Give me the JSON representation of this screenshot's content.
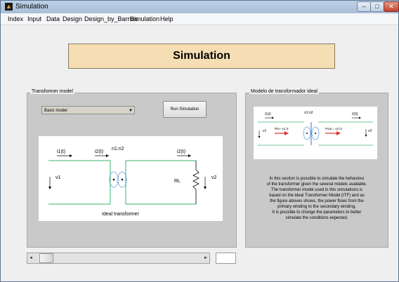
{
  "window": {
    "title": "Simulation",
    "controls": {
      "minimize": "–",
      "maximize": "□",
      "close": "✕"
    }
  },
  "menu": {
    "items": [
      "Index",
      "Input",
      "Data",
      "Design",
      "Design_by_Barrios",
      "Simulation",
      "Help"
    ]
  },
  "banner": {
    "title": "Simulation"
  },
  "transformer_panel": {
    "title": "Transformer model",
    "model_select": {
      "value": "Basic model"
    },
    "run_button": "Run Simulation",
    "diagram": {
      "labels": {
        "i1": "i1(t)",
        "i2": "i2(t)",
        "ratio": "n1:n2",
        "i2r": "i2(t)",
        "v1": "v1",
        "rl": "RL",
        "v2": "v2",
        "caption": "Ideal transformer"
      }
    }
  },
  "ideal_panel": {
    "title": "Modelo de transformador ideal",
    "diagram": {
      "labels": {
        "i1": "i1(t)",
        "ratio": "n1:n2",
        "i2": "i2(t)",
        "v1": "v1",
        "p_in": "Pin= v1 i1",
        "p_out": "Pout = v2 i2",
        "v2": "v2"
      }
    },
    "description": [
      "In this section is possible to simulate the behaviour",
      "of the transformer given the several models available.",
      "The transformer model used in this simulations is",
      "based on the ideal Transformer Model (ITF) and as",
      "the figure aboves shows, the power flows from the",
      "primary winding to the secondary winding.",
      "It is possible to change the parameters to better",
      "simulate the conditions expected."
    ]
  },
  "slider": {
    "value": "",
    "position_fraction": 0.03,
    "left_arrow": "◄",
    "right_arrow": "►"
  },
  "icons": {
    "app": "matlab-figure-icon",
    "dropdown": "chevron-down-icon"
  },
  "colors": {
    "banner": "#f5deb3",
    "panel": "#c9c9c9",
    "wire": "#3cb371",
    "power_arrow": "#e03030"
  }
}
